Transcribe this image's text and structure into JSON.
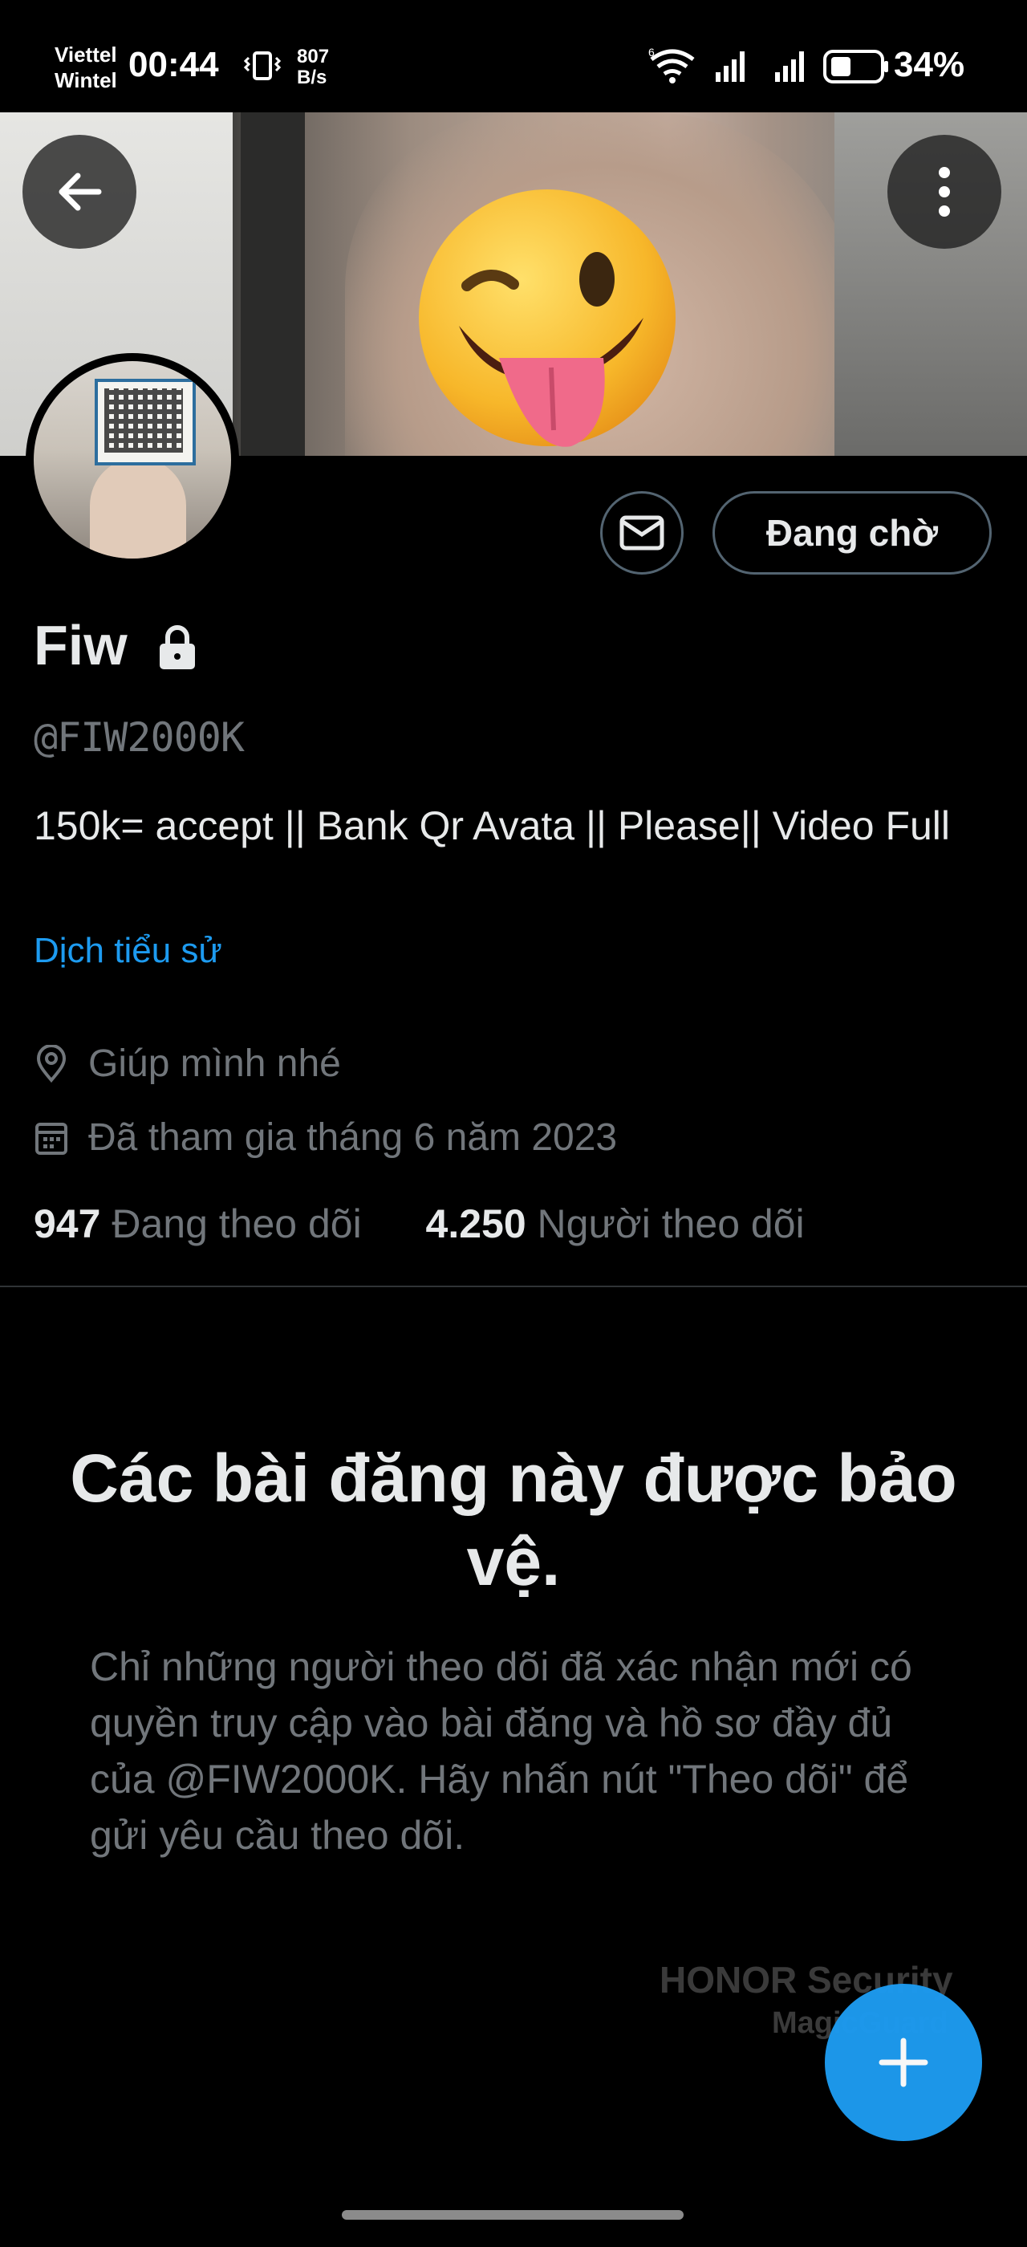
{
  "status_bar": {
    "carrier_line1": "Viettel",
    "carrier_line2": "Wintel",
    "time": "00:44",
    "net_speed_value": "807",
    "net_speed_unit": "B/s",
    "battery": "34%",
    "icons": [
      "vibrate-icon",
      "wifi-icon",
      "signal-icon",
      "signal-icon",
      "battery-icon"
    ]
  },
  "header": {
    "back_icon": "arrow-left-icon",
    "more_icon": "more-vertical-icon"
  },
  "profile": {
    "name": "Fiw",
    "handle": "@FIW2000K",
    "bio": "150k= accept || Bank Qr Avata ||  Please|| Video Full",
    "translate_label": "Dịch tiểu sử",
    "location": "Giúp mình nhé",
    "joined": "Đã tham gia tháng 6 năm 2023",
    "following_count": "947",
    "following_label": "Đang theo dõi",
    "followers_count": "4.250",
    "followers_label": "Người theo dõi"
  },
  "actions": {
    "pending_label": "Đang chờ",
    "message_icon": "mail-icon"
  },
  "protected": {
    "title": "Các bài đăng này được bảo vệ.",
    "body": "Chỉ những người theo dõi đã xác nhận mới có quyền truy cập vào bài đăng và hồ sơ đầy đủ của @FIW2000K. Hãy nhấn nút \"Theo dõi\" để gửi yêu cầu theo dõi."
  },
  "watermark": {
    "line1": "HONOR Security",
    "line2": "MagicGuard"
  },
  "colors": {
    "background": "#000000",
    "text_primary": "#e7e9ea",
    "text_secondary": "#71767b",
    "accent": "#1d9bf0",
    "border": "#536471"
  }
}
